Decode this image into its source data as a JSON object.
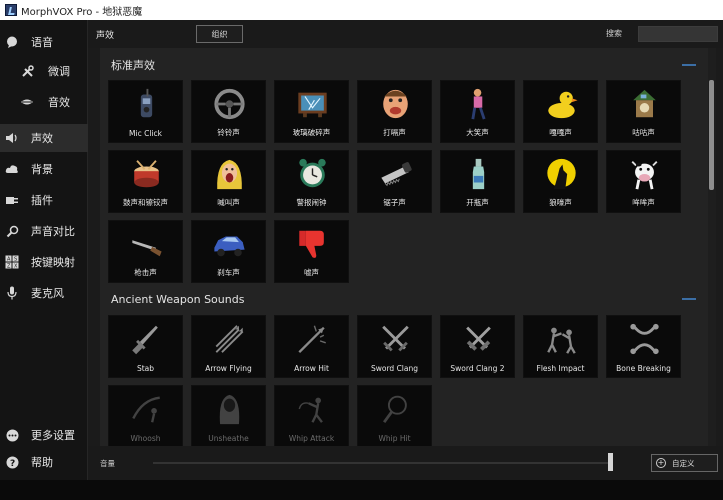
{
  "window": {
    "title": "MorphVOX Pro - 地狱恶魔"
  },
  "sidebar": {
    "items": [
      {
        "label": "语音",
        "icon": "speech-bubble-icon"
      },
      {
        "label": "微调",
        "icon": "tools-icon"
      },
      {
        "label": "音效",
        "icon": "lips-icon"
      },
      {
        "label": "声效",
        "icon": "speaker-icon"
      },
      {
        "label": "背景",
        "icon": "cloud-icon"
      },
      {
        "label": "插件",
        "icon": "plugin-icon"
      },
      {
        "label": "声音对比",
        "icon": "magnifier-icon"
      },
      {
        "label": "按键映射",
        "icon": "keyboard-icon"
      },
      {
        "label": "麦克风",
        "icon": "microphone-icon"
      },
      {
        "label": "更多设置",
        "icon": "more-icon"
      },
      {
        "label": "帮助",
        "icon": "help-icon"
      }
    ]
  },
  "header": {
    "title": "声效",
    "organize_label": "组织",
    "search_label": "搜索",
    "search_value": ""
  },
  "sections": [
    {
      "title": "标准声效",
      "tiles": [
        {
          "label": "Mic Click",
          "icon": "walkie-talkie-icon"
        },
        {
          "label": "铃铃声",
          "icon": "steering-wheel-icon"
        },
        {
          "label": "玻璃破碎声",
          "icon": "broken-tv-icon"
        },
        {
          "label": "打嗝声",
          "icon": "face-icon"
        },
        {
          "label": "大笑声",
          "icon": "laughing-man-icon"
        },
        {
          "label": "嘎嘎声",
          "icon": "duck-icon"
        },
        {
          "label": "咕咕声",
          "icon": "cuckoo-clock-icon"
        },
        {
          "label": "鼓声和镲铰声",
          "icon": "drum-icon"
        },
        {
          "label": "喊叫声",
          "icon": "screaming-woman-icon"
        },
        {
          "label": "警报闹钟",
          "icon": "alarm-clock-icon"
        },
        {
          "label": "锯子声",
          "icon": "saw-icon"
        },
        {
          "label": "开瓶声",
          "icon": "bottle-icon"
        },
        {
          "label": "狼嚎声",
          "icon": "wolf-moon-icon"
        },
        {
          "label": "哞哞声",
          "icon": "cow-icon"
        },
        {
          "label": "枪击声",
          "icon": "gun-icon"
        },
        {
          "label": "刹车声",
          "icon": "car-icon"
        },
        {
          "label": "嘘声",
          "icon": "thumbs-down-icon"
        }
      ]
    },
    {
      "title": "Ancient Weapon Sounds",
      "tiles": [
        {
          "label": "Stab",
          "icon": "dagger-icon"
        },
        {
          "label": "Arrow Flying",
          "icon": "arrows-icon"
        },
        {
          "label": "Arrow Hit",
          "icon": "arrow-hit-icon"
        },
        {
          "label": "Sword Clang",
          "icon": "crossed-swords-icon"
        },
        {
          "label": "Sword Clang 2",
          "icon": "crossed-swords-2-icon"
        },
        {
          "label": "Flesh Impact",
          "icon": "fighters-icon"
        },
        {
          "label": "Bone Breaking",
          "icon": "bone-icon"
        },
        {
          "label": "Whoosh",
          "icon": "whoosh-icon"
        },
        {
          "label": "Unsheathe",
          "icon": "hooded-figure-icon"
        },
        {
          "label": "Whip Attack",
          "icon": "whip-attack-icon"
        },
        {
          "label": "Whip Hit",
          "icon": "whip-icon"
        }
      ]
    }
  ],
  "bottom": {
    "volume_label": "音量",
    "volume_level": 0.95,
    "custom_label": "自定义"
  },
  "scrollbar": {
    "position": 0.1
  }
}
